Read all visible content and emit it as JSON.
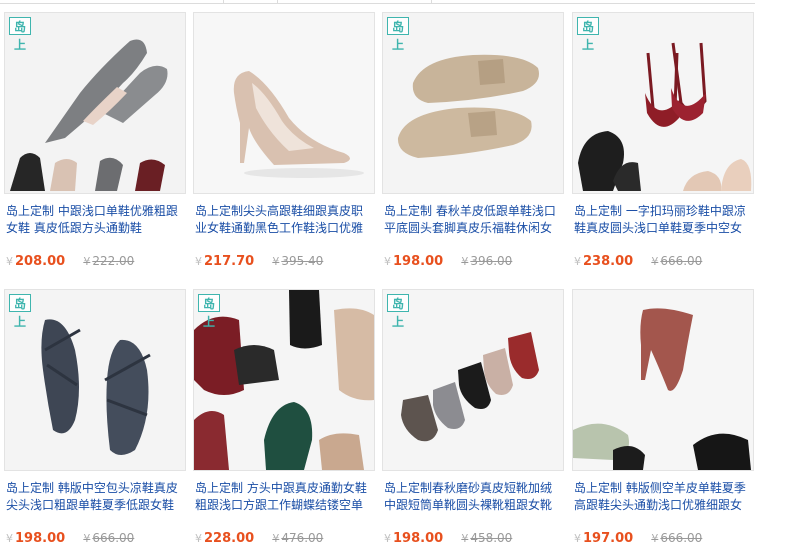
{
  "brand_badge": "岛上",
  "currency_symbol": "¥",
  "products": [
    {
      "title": "岛上定制 中跟浅口单鞋优雅粗跟女鞋 真皮低跟方头通勤鞋",
      "price": "208.00",
      "original_price": "222.00",
      "image": "gray-block-heel-pumps"
    },
    {
      "title": "岛上定制尖头高跟鞋细跟真皮职业女鞋通勤黑色工作鞋浅口优雅",
      "price": "217.70",
      "original_price": "395.40",
      "image": "nude-stiletto-pump"
    },
    {
      "title": "岛上定制 春秋羊皮低跟单鞋浅口平底圆头套脚真皮乐福鞋休闲女",
      "price": "198.00",
      "original_price": "396.00",
      "image": "beige-suede-loafers"
    },
    {
      "title": "岛上定制 一字扣玛丽珍鞋中跟凉鞋真皮圆头浅口单鞋夏季中空女",
      "price": "238.00",
      "original_price": "666.00",
      "image": "red-patent-mary-janes"
    },
    {
      "title": "岛上定制 韩版中空包头凉鞋真皮尖头浅口粗跟单鞋夏季低跟女鞋",
      "price": "198.00",
      "original_price": "666.00",
      "image": "navy-cross-strap-flats"
    },
    {
      "title": "岛上定制 方头中跟真皮通勤女鞋粗跟浅口方跟工作蝴蝶结镂空单",
      "price": "228.00",
      "original_price": "476.00",
      "image": "square-toe-bow-pumps"
    },
    {
      "title": "岛上定制春秋磨砂真皮短靴加绒中跟短筒单靴圆头裸靴粗跟女靴",
      "price": "198.00",
      "original_price": "458.00",
      "image": "suede-ankle-boots"
    },
    {
      "title": "岛上定制 韩版侧空羊皮单鞋夏季高跟鞋尖头通勤浅口优雅细跟女",
      "price": "197.00",
      "original_price": "666.00",
      "image": "suede-dorsay-heels"
    }
  ],
  "colors": {
    "title_link": "#1a4ea6",
    "price": "#e8501e",
    "old_price": "#999999",
    "badge": "#3fb5ae",
    "border": "#e3e3e3"
  }
}
